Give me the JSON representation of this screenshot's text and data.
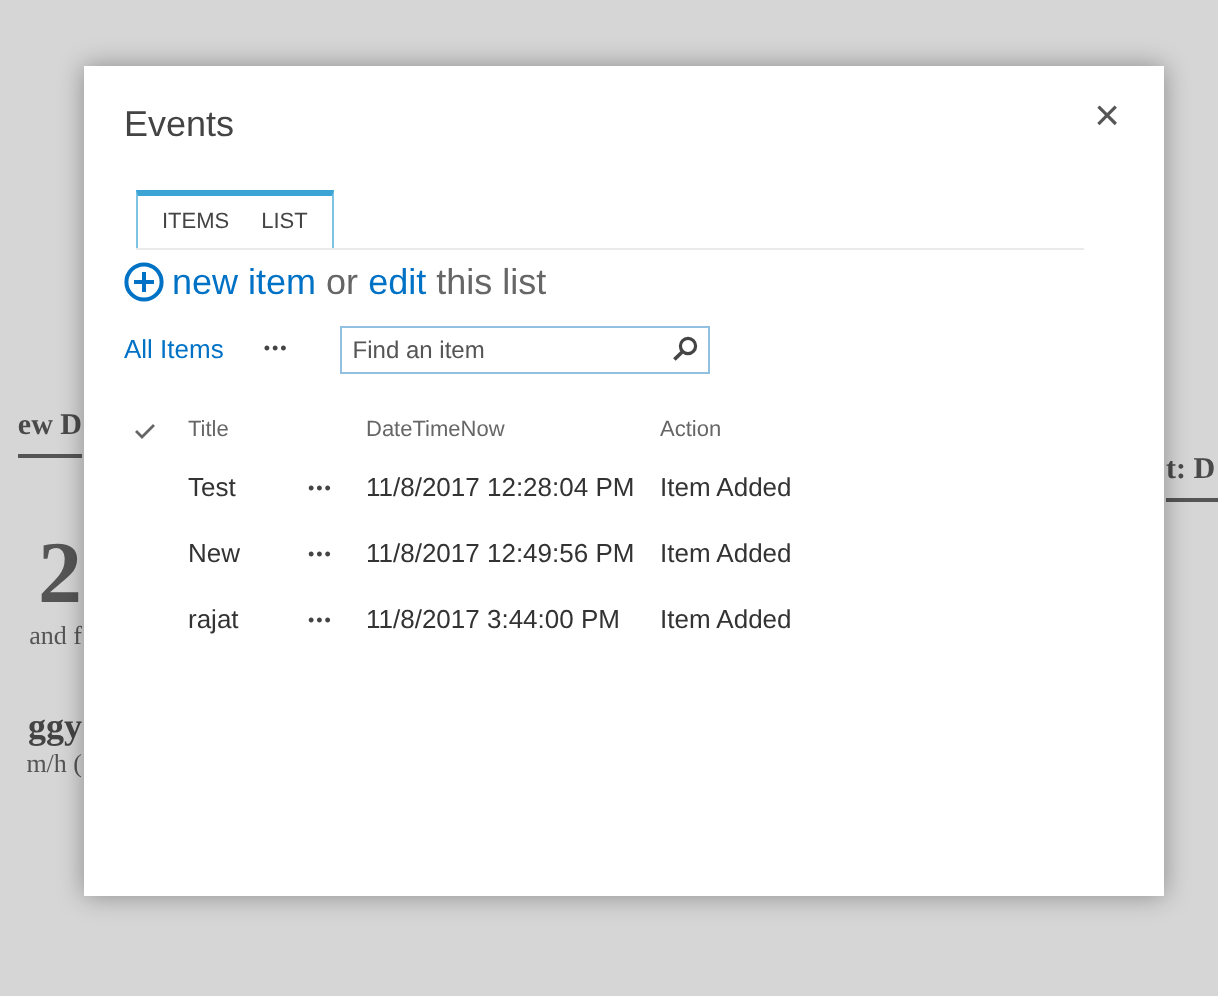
{
  "background": {
    "left_texts": [
      {
        "kind": "heading",
        "text": "ew D"
      },
      {
        "kind": "big",
        "text": "2"
      },
      {
        "kind": "text",
        "text": "and f"
      },
      {
        "kind": "subheading",
        "text": "ggy"
      },
      {
        "kind": "text",
        "text": "m/h ("
      }
    ],
    "right_texts": [
      {
        "kind": "heading",
        "text": "t: D"
      }
    ]
  },
  "dialog": {
    "title": "Events",
    "close": "×",
    "tabs": [
      {
        "label": "ITEMS"
      },
      {
        "label": "LIST"
      }
    ],
    "command": {
      "new_item": "new item",
      "or": "or",
      "edit": "edit",
      "this_list": "this list"
    },
    "view": "All Items",
    "view_menu": "•••",
    "search": {
      "placeholder": "Find an item"
    },
    "table": {
      "columns": [
        "Title",
        "DateTimeNow",
        "Action"
      ],
      "rows": [
        {
          "title": "Test",
          "menu": "•••",
          "datetime": "11/8/2017 12:28:04 PM",
          "action": "Item Added"
        },
        {
          "title": "New",
          "menu": "•••",
          "datetime": "11/8/2017 12:49:56 PM",
          "action": "Item Added"
        },
        {
          "title": "rajat",
          "menu": "•••",
          "datetime": "11/8/2017 3:44:00 PM",
          "action": "Item Added"
        }
      ]
    }
  }
}
